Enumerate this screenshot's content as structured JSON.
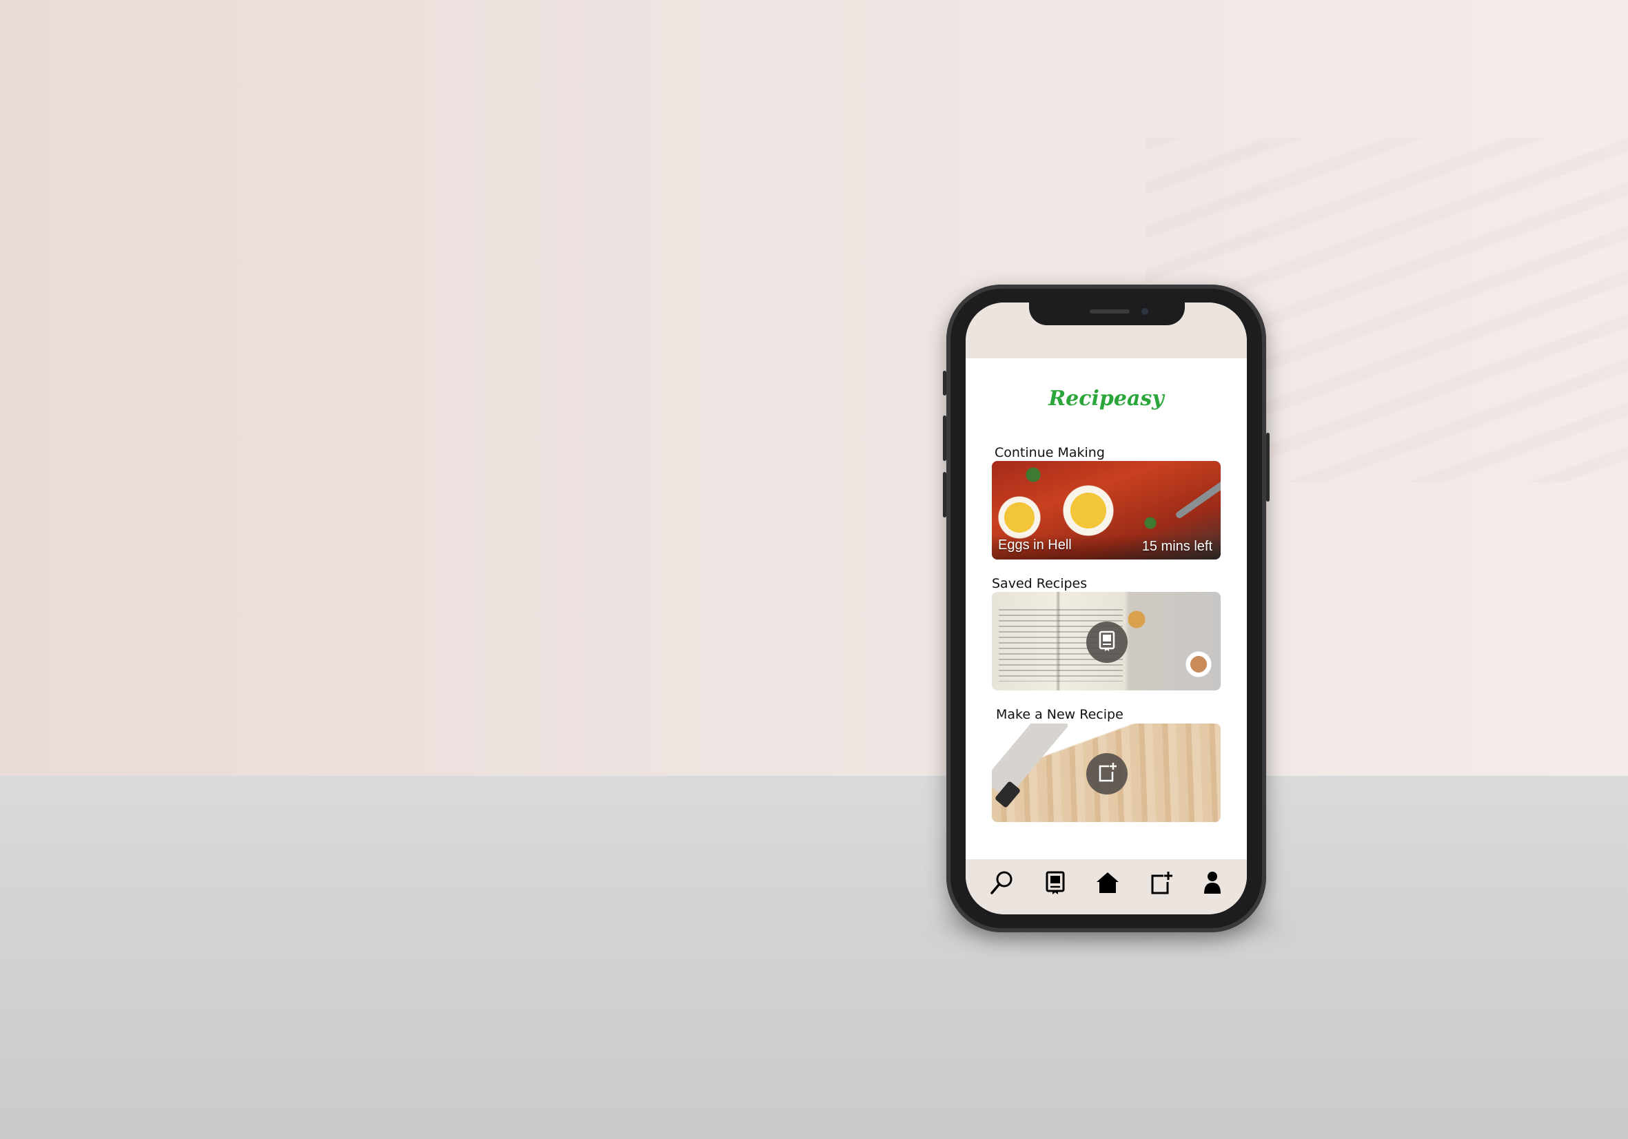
{
  "app": {
    "title": "Recipeasy"
  },
  "sections": {
    "continue_making": {
      "label": "Continue Making",
      "recipe_name": "Eggs in Hell",
      "time_left": "15 mins left"
    },
    "saved_recipes": {
      "label": "Saved Recipes",
      "icon": "recipe-book-icon"
    },
    "new_recipe": {
      "label": "Make a New Recipe",
      "icon": "add-document-icon"
    }
  },
  "tabbar": {
    "items": [
      {
        "icon": "search-icon"
      },
      {
        "icon": "recipe-book-icon"
      },
      {
        "icon": "home-icon"
      },
      {
        "icon": "add-document-icon"
      },
      {
        "icon": "profile-icon"
      }
    ]
  },
  "colors": {
    "accent": "#2aa63a",
    "bar_background": "#ece5df",
    "icon_button": "#55504b"
  }
}
